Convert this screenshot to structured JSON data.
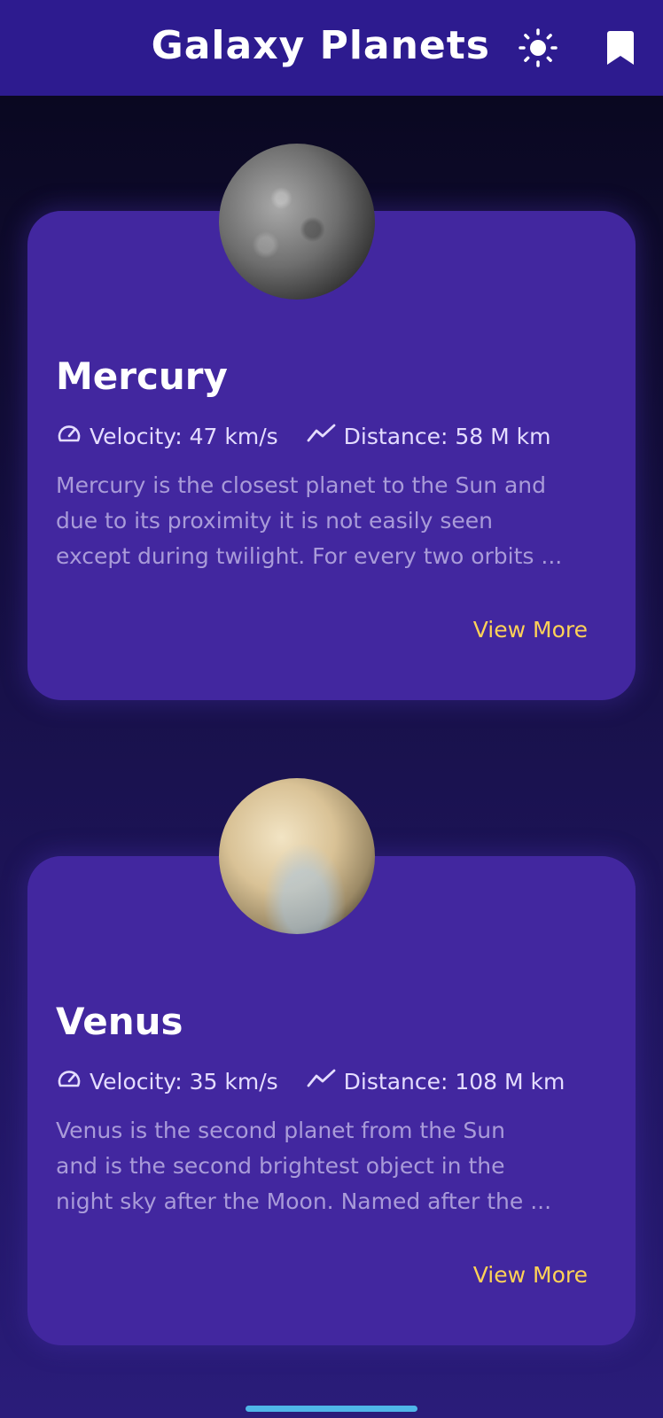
{
  "app": {
    "title": "Galaxy Planets",
    "icons": {
      "theme": "sun-icon",
      "bookmark": "bookmark-icon"
    }
  },
  "planets": [
    {
      "name": "Mercury",
      "velocity": "Velocity: 47 km/s",
      "distance": "Distance: 58 M km",
      "description_lines": [
        "Mercury is the closest planet to the Sun and",
        "due to its proximity it is not easily seen",
        "except during twilight. For every two orbits ..."
      ],
      "action": "View More"
    },
    {
      "name": "Venus",
      "velocity": "Velocity: 35 km/s",
      "distance": "Distance: 108 M km",
      "description_lines": [
        "Venus is the second planet from the Sun",
        "and is the second brightest object in the",
        "night sky after the Moon. Named after the ..."
      ],
      "action": "View More"
    }
  ],
  "colors": {
    "appbar": "#2d1b8f",
    "card": "#42279f",
    "accent": "#ffd257",
    "description": "#a99bd9",
    "home_indicator": "#4fb6e8"
  }
}
